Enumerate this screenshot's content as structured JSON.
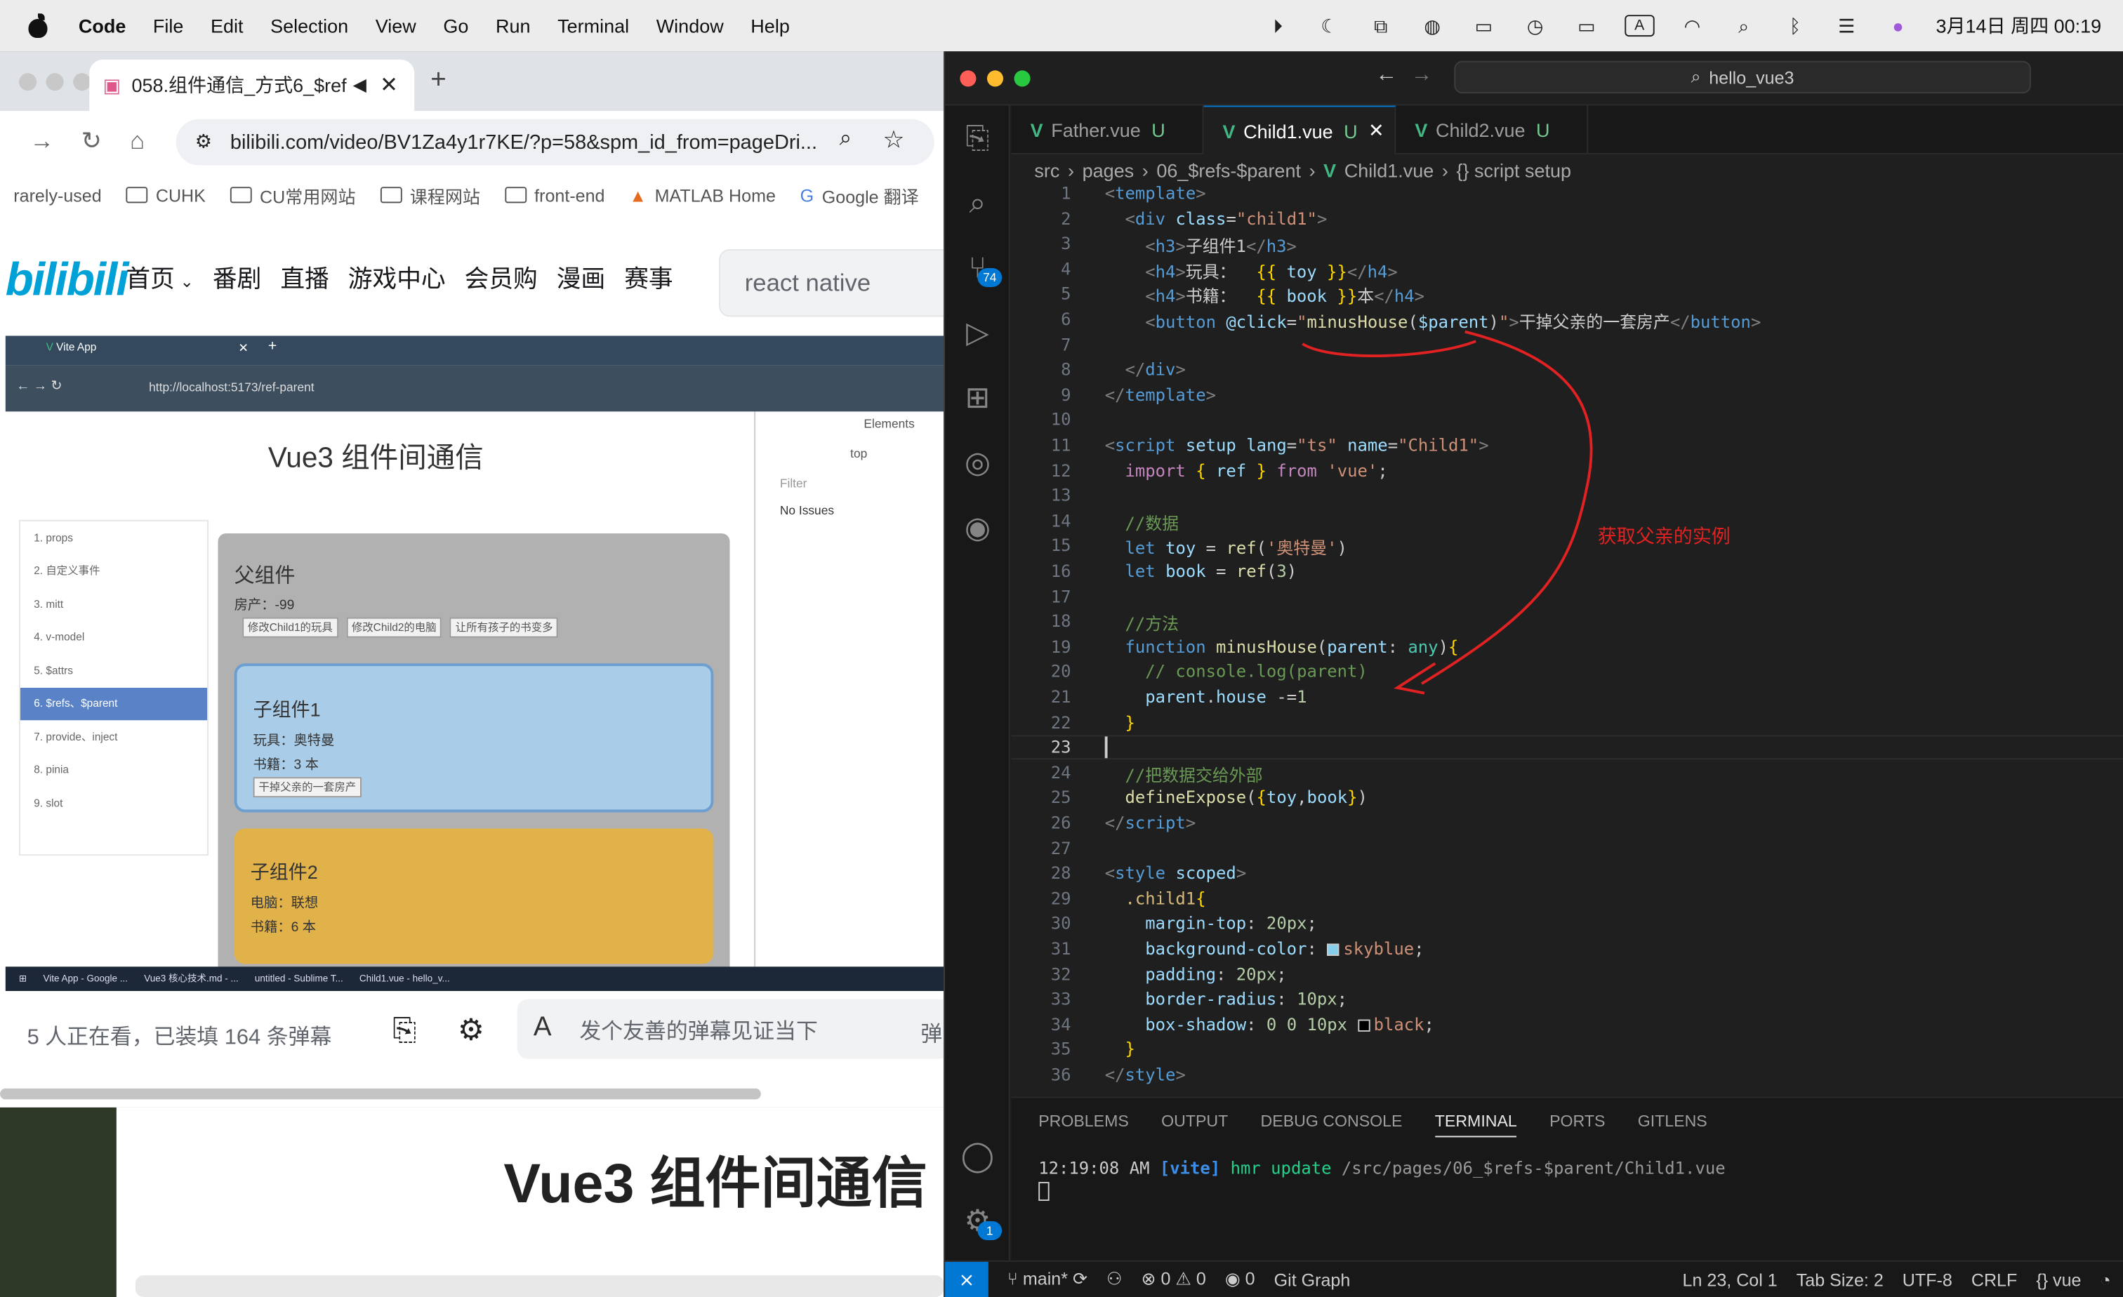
{
  "menubar": {
    "app_name": "Code",
    "items": [
      "File",
      "Edit",
      "Selection",
      "View",
      "Go",
      "Run",
      "Terminal",
      "Window",
      "Help"
    ],
    "ime": "A",
    "datetime": "3月14日 周四  00:19"
  },
  "chrome": {
    "tab_title": "058.组件通信_方式6_$ref",
    "url": "bilibili.com/video/BV1Za4y1r7KE/?p=58&spm_id_from=pageDri...",
    "bookmarks": [
      "rarely-used",
      "CUHK",
      "CU常用网站",
      "课程网站",
      "front-end",
      "MATLAB Home",
      "Google 翻译"
    ]
  },
  "bili": {
    "logo": "bilibili",
    "nav": [
      "首页",
      "番剧",
      "直播",
      "游戏中心",
      "会员购",
      "漫画",
      "赛事"
    ],
    "search_value": "react native",
    "viewers": "5 人正在看，已装填 164 条弹幕",
    "danmaku_placeholder": "发个友善的弹幕见证当下",
    "danmaku_send": "弹",
    "lower_title": "Vue3 组件间通信"
  },
  "video": {
    "tab": "Vite App",
    "url": "http://localhost:5173/ref-parent",
    "title": "Vue3 组件间通信",
    "sidebar": [
      "1. props",
      "2. 自定义事件",
      "3. mitt",
      "4. v-model",
      "5. $attrs",
      "6. $refs、$parent",
      "7. provide、inject",
      "8. pinia",
      "9. slot"
    ],
    "active_index": 5,
    "father_title": "父组件",
    "father_house": "房产：-99",
    "father_buttons": [
      "修改Child1的玩具",
      "修改Child2的电脑",
      "让所有孩子的书变多"
    ],
    "child1_title": "子组件1",
    "child1_toy": "玩具：奥特曼",
    "child1_book": "书籍：3 本",
    "child1_button": "干掉父亲的一套房产",
    "child2_title": "子组件2",
    "child2_pc": "电脑：联想",
    "child2_book": "书籍：6 本",
    "devtools": {
      "tab": "Elements",
      "context": "top",
      "filter": "Filter",
      "issues": "No Issues"
    },
    "taskbar": [
      "Vite App - Google ...",
      "Vue3 核心技术.md - ...",
      "untitled - Sublime T...",
      "Child1.vue - hello_v..."
    ]
  },
  "vscode": {
    "search": "hello_vue3",
    "tabs": [
      {
        "name": "Father.vue",
        "status": "U"
      },
      {
        "name": "Child1.vue",
        "status": "U"
      },
      {
        "name": "Child2.vue",
        "status": "U"
      }
    ],
    "breadcrumb": [
      "src",
      "pages",
      "06_$refs-$parent",
      "Child1.vue",
      "{} script setup"
    ],
    "scm_badge": "74",
    "settings_badge": "1",
    "annotation": "获取父亲的实例",
    "panel_tabs": [
      "PROBLEMS",
      "OUTPUT",
      "DEBUG CONSOLE",
      "TERMINAL",
      "PORTS",
      "GITLENS"
    ],
    "terminal_time": "12:19:08 AM",
    "terminal_tag": "[vite]",
    "terminal_msg": "hmr update",
    "terminal_path": "/src/pages/06_$refs-$parent/Child1.vue",
    "status": {
      "branch": "main*",
      "errors": "0",
      "warnings": "0",
      "ports": "0",
      "git_graph": "Git Graph",
      "position": "Ln 23, Col 1",
      "tab_size": "Tab Size: 2",
      "encoding": "UTF-8",
      "eol": "CRLF",
      "language": "vue"
    }
  },
  "colors": {
    "vue_green": "#41b883",
    "bili_blue": "#00a1d6",
    "vscode_blue": "#0078d4",
    "annotation_red": "#e22222"
  }
}
